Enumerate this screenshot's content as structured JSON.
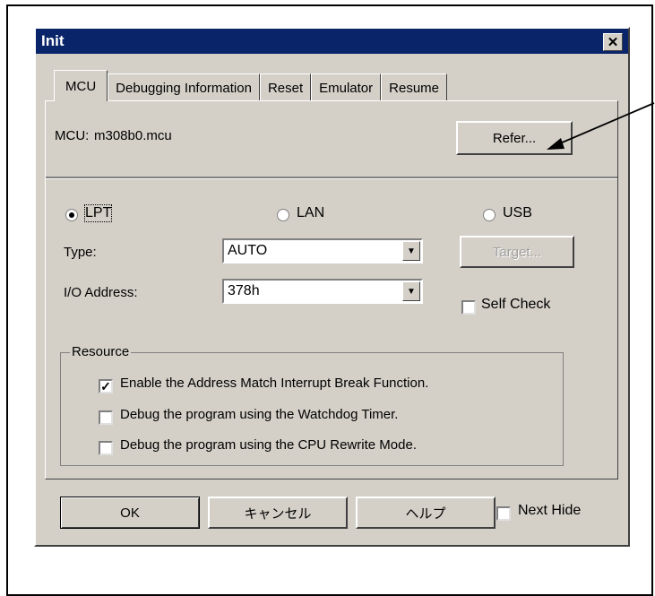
{
  "window": {
    "title": "Init"
  },
  "tabs": [
    "MCU",
    "Debugging Information",
    "Reset",
    "Emulator",
    "Resume"
  ],
  "mcu": {
    "label": "MCU:",
    "value": "m308b0.mcu",
    "refer_button": "Refer..."
  },
  "connection": {
    "options": [
      "LPT",
      "LAN",
      "USB"
    ],
    "selected": "LPT"
  },
  "type": {
    "label": "Type:",
    "value": "AUTO"
  },
  "io_address": {
    "label": "I/O Address:",
    "value": "378h"
  },
  "target_button": "Target...",
  "self_check": {
    "label": "Self Check",
    "checked": false
  },
  "resource": {
    "title": "Resource",
    "items": [
      {
        "label": "Enable the Address Match Interrupt Break Function.",
        "checked": true
      },
      {
        "label": "Debug the program using the Watchdog Timer.",
        "checked": false
      },
      {
        "label": "Debug the program using the CPU Rewrite Mode.",
        "checked": false
      }
    ]
  },
  "footer": {
    "ok": "OK",
    "cancel": "キャンセル",
    "help": "ヘルプ",
    "next_hide": "Next Hide"
  },
  "colors": {
    "titlebar": "#0a246a",
    "dialog_bg": "#d4d0c8"
  }
}
